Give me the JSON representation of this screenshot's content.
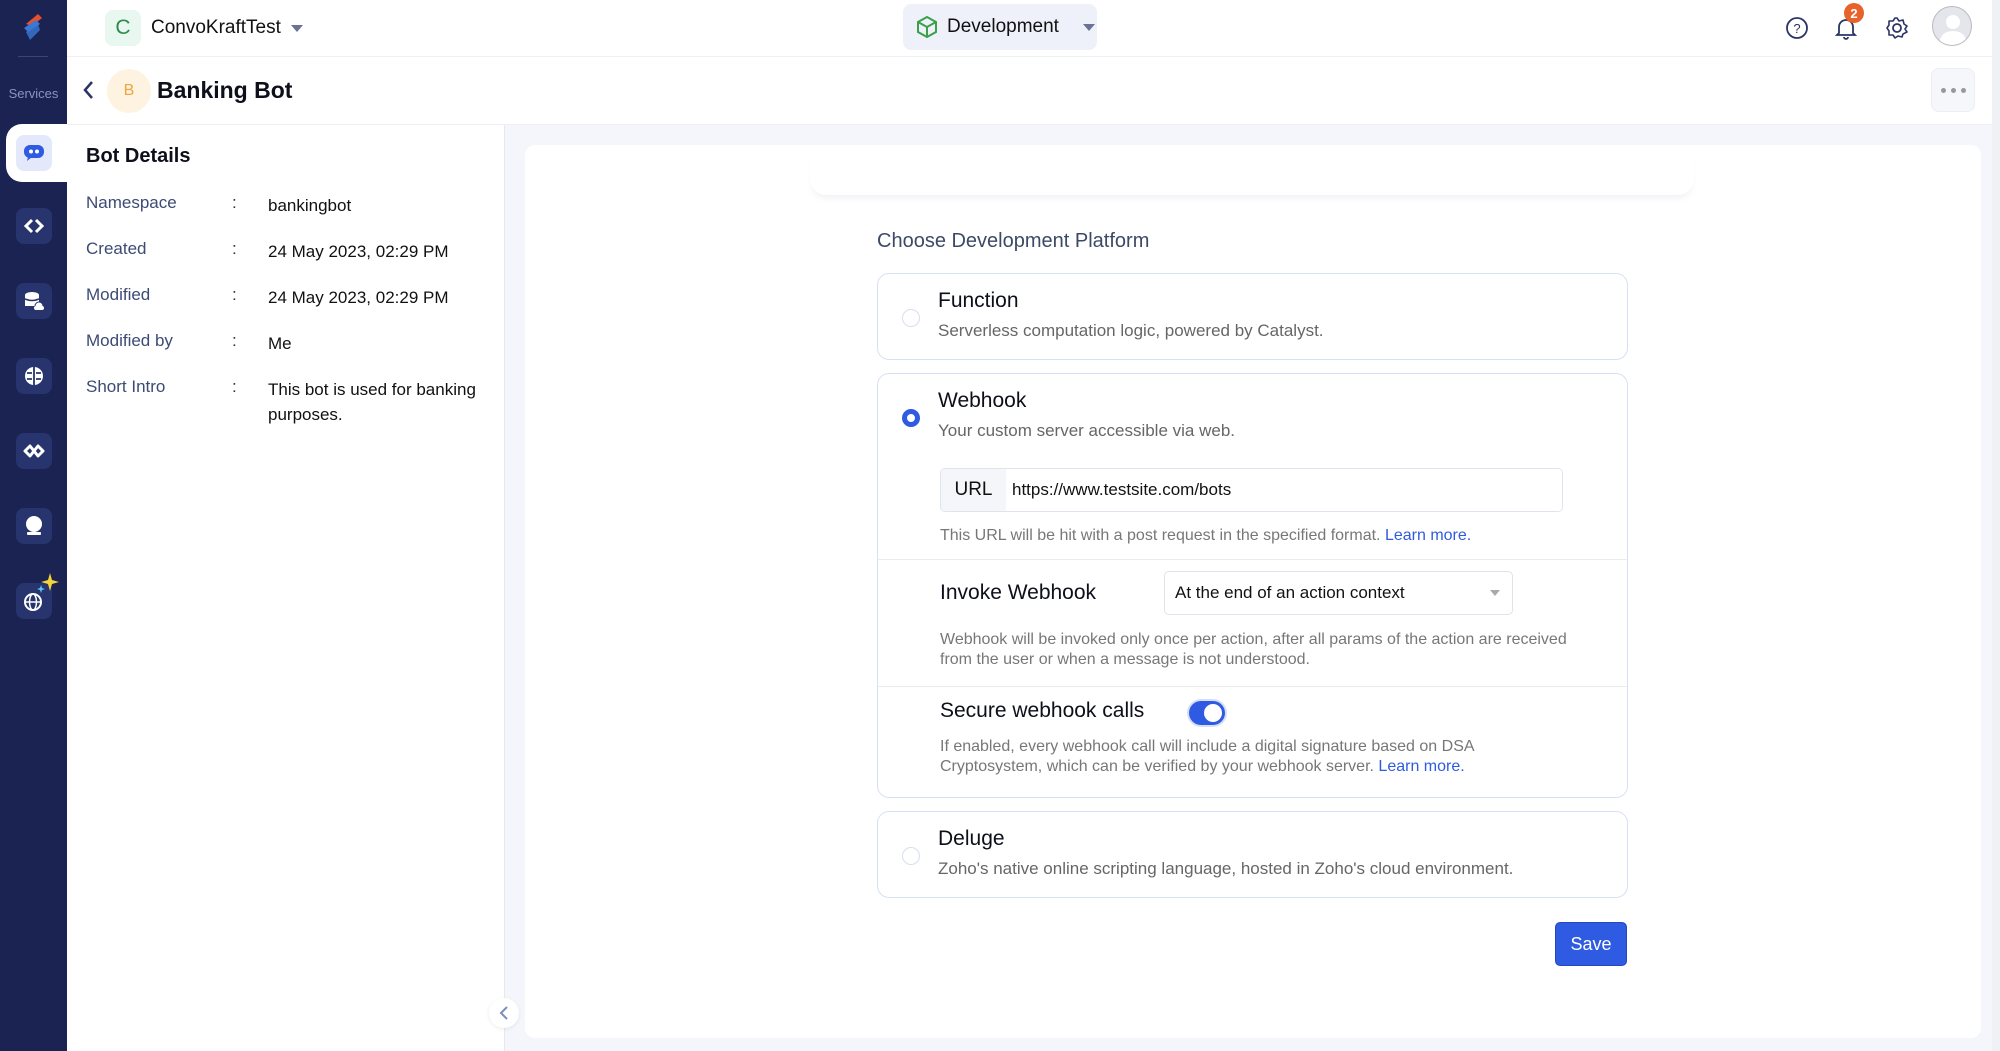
{
  "rail": {
    "services_label": "Services",
    "items": [
      {
        "name": "bot-icon",
        "active": true
      },
      {
        "name": "code-icon"
      },
      {
        "name": "database-cloud-icon"
      },
      {
        "name": "brain-icon"
      },
      {
        "name": "integration-icon"
      },
      {
        "name": "crystal-ball-icon"
      },
      {
        "name": "ai-globe-icon"
      }
    ]
  },
  "topbar": {
    "project_initial": "C",
    "project_name": "ConvoKraftTest",
    "environment": "Development",
    "notification_count": "2"
  },
  "subbar": {
    "bot_initial": "B",
    "bot_name": "Banking Bot"
  },
  "details": {
    "title": "Bot Details",
    "separator": ":",
    "rows": [
      {
        "key": "Namespace",
        "value": "bankingbot"
      },
      {
        "key": "Created",
        "value": "24 May 2023, 02:29 PM"
      },
      {
        "key": "Modified",
        "value": "24 May 2023, 02:29 PM"
      },
      {
        "key": "Modified by",
        "value": "Me"
      },
      {
        "key": "Short Intro",
        "value": "This bot is used for banking purposes."
      }
    ]
  },
  "platform": {
    "heading": "Choose Development Platform",
    "options": [
      {
        "title": "Function",
        "desc": "Serverless computation logic, powered by Catalyst.",
        "selected": false
      },
      {
        "title": "Webhook",
        "desc": "Your custom server accessible via web.",
        "selected": true
      },
      {
        "title": "Deluge",
        "desc": "Zoho's native online scripting language, hosted in Zoho's cloud environment.",
        "selected": false
      }
    ],
    "webhook": {
      "url_label": "URL",
      "url_value": "https://www.testsite.com/bots",
      "url_hint": "This URL will be hit with a post request in the specified format.",
      "learn_more": "Learn more.",
      "invoke_label": "Invoke Webhook",
      "invoke_value": "At the end of an action context",
      "invoke_hint": "Webhook will be invoked only once per action, after all params of the action are received from the user or when a message is not understood.",
      "secure_label": "Secure webhook calls",
      "secure_enabled": true,
      "secure_hint": "If enabled, every webhook call will include a digital signature based on DSA Cryptosystem, which can be verified by your webhook server."
    },
    "save_label": "Save"
  },
  "colors": {
    "accent": "#2e5be1",
    "rail": "#1b2352",
    "badge": "#e8632b"
  }
}
